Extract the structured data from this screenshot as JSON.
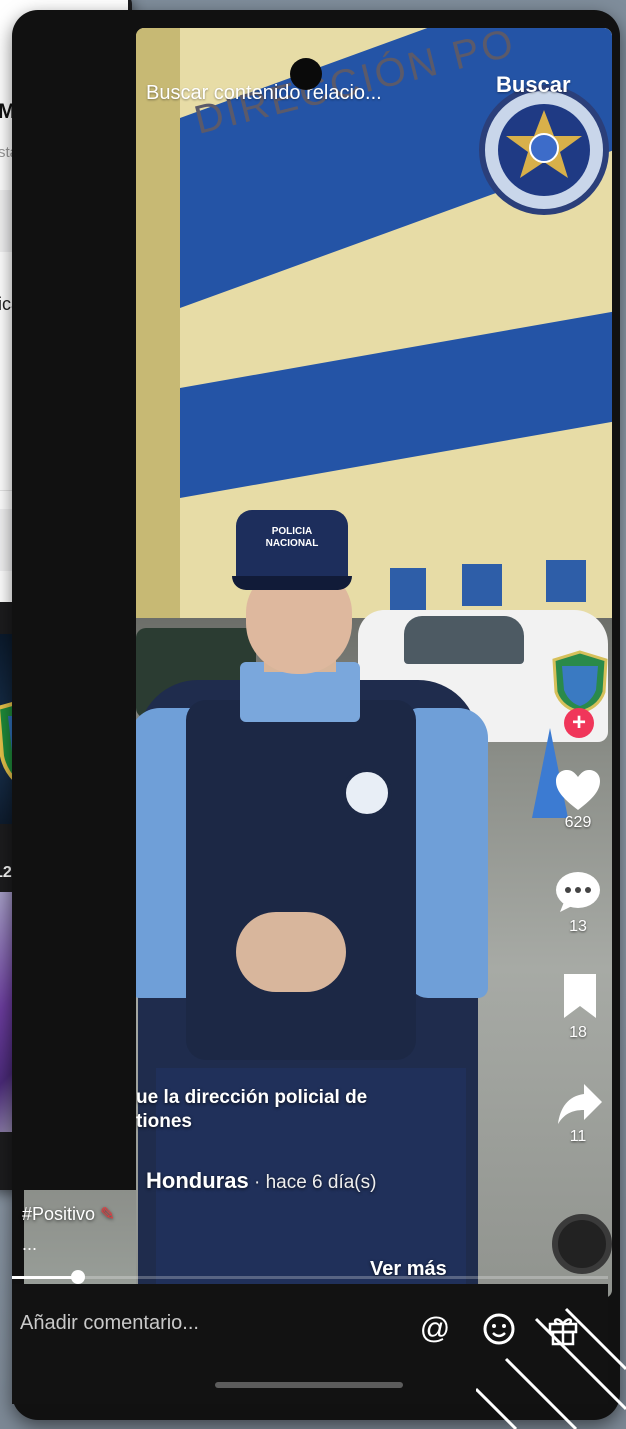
{
  "left_app": {
    "profile_name": "M",
    "profile_sub": "sta",
    "publication_text": "icación",
    "video_count": "12"
  },
  "main_app": {
    "search_placeholder": "Buscar contenido relacio...",
    "search_button": "Buscar",
    "building_sign": "DIRECCIÓN PO",
    "cap_text": "POLICIA NACIONAL",
    "rail": {
      "like_count": "629",
      "comment_count": "13",
      "save_count": "18",
      "share_count": "11"
    },
    "caption": "ue la dirección policial de\ntiones",
    "author": "Honduras",
    "author_time": " · hace 6 día(s)",
    "hashtag": "#Positivo",
    "ellipsis": "...",
    "see_more": "Ver más",
    "progress_fraction": 0.11,
    "comment_placeholder": "Añadir comentario...",
    "bottom_icons": [
      "at-icon",
      "emoji-icon",
      "gift-icon"
    ]
  },
  "colors": {
    "accent_red": "#f0365a",
    "police_blue": "#2454a6"
  }
}
